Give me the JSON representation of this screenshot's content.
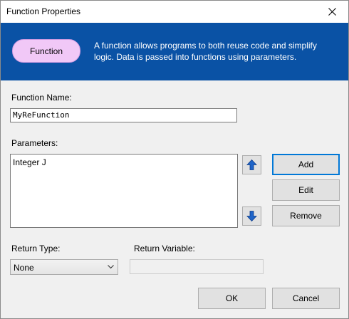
{
  "window": {
    "title": "Function Properties"
  },
  "banner": {
    "pill_label": "Function",
    "description": "A function allows programs to both reuse code and simplify logic. Data is passed into functions using parameters."
  },
  "function_name": {
    "label": "Function Name:",
    "value": "MyReFunction"
  },
  "parameters": {
    "label": "Parameters:",
    "items": [
      "Integer J"
    ]
  },
  "buttons": {
    "add": "Add",
    "edit": "Edit",
    "remove": "Remove",
    "ok": "OK",
    "cancel": "Cancel"
  },
  "return_type": {
    "label": "Return Type:",
    "selected": "None"
  },
  "return_variable": {
    "label": "Return Variable:",
    "value": ""
  },
  "colors": {
    "banner": "#0a52a5",
    "pill": "#f1c8f7",
    "arrow": "#1f64c8",
    "default_button_border": "#0078d7"
  },
  "icons": {
    "close": "close-icon",
    "move_up": "arrow-up-icon",
    "move_down": "arrow-down-icon",
    "dropdown": "chevron-down-icon"
  }
}
